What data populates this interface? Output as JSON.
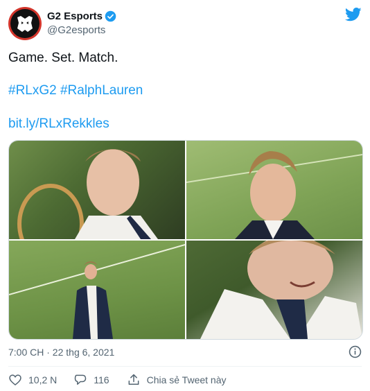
{
  "account": {
    "name": "G2 Esports",
    "handle": "@G2esports",
    "avatar_icon": "g2-logo-icon"
  },
  "tweet": {
    "line1": "Game. Set. Match.",
    "hashtags": [
      "#RLxG2",
      "#RalphLauren"
    ],
    "link": "bit.ly/RLxRekkles"
  },
  "media": {
    "photos": [
      {
        "name": "photo-1",
        "desc_icon": "photo"
      },
      {
        "name": "photo-2",
        "desc_icon": "photo"
      },
      {
        "name": "photo-3",
        "desc_icon": "photo"
      },
      {
        "name": "photo-4",
        "desc_icon": "photo"
      }
    ]
  },
  "meta": {
    "timestamp": "7:00 CH · 22 thg 6, 2021"
  },
  "actions": {
    "likes": "10,2 N",
    "replies": "116",
    "share_label": "Chia sẻ Tweet này"
  },
  "colors": {
    "link": "#1d9bf0",
    "muted": "#536471",
    "text": "#0f1419",
    "verified": "#1d9bf0",
    "brand_red": "#d3352b"
  }
}
